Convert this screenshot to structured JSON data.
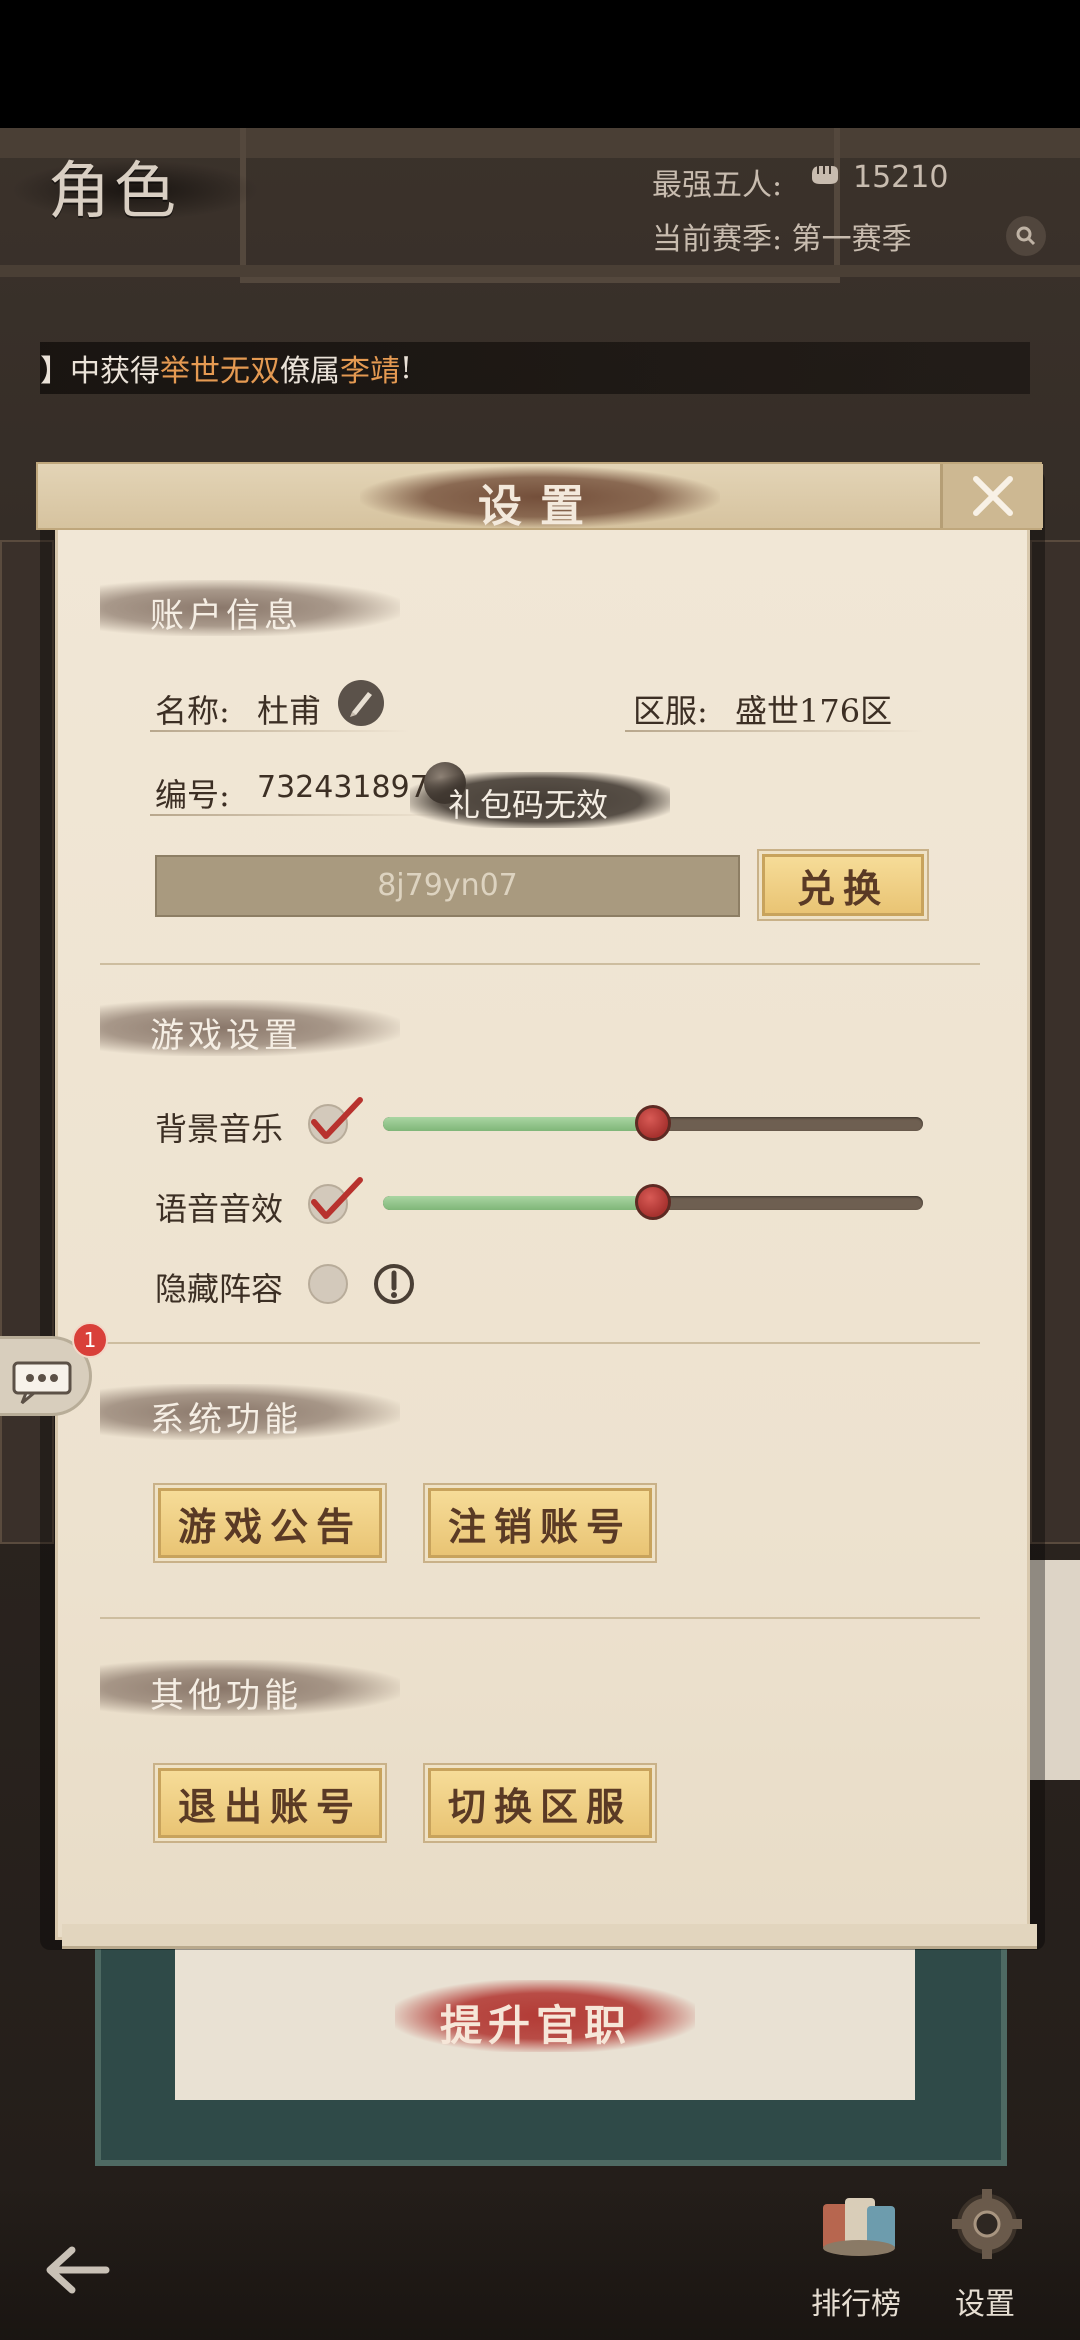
{
  "header": {
    "title": "角色",
    "strongest_label": "最强五人:",
    "strongest_value": "15210",
    "season_label": "当前赛季: 第一赛季"
  },
  "marquee": {
    "prefix": "】中获得",
    "highlight1": "举世无双",
    "middle": "僚属",
    "highlight2": "李靖",
    "suffix": "!"
  },
  "dialog": {
    "title": "设置",
    "account": {
      "section_title": "账户信息",
      "name_label": "名称:",
      "name_value": "杜甫",
      "server_label": "区服:",
      "server_value": "盛世176区",
      "id_label": "编号:",
      "id_value": "732431897",
      "toast": "礼包码无效",
      "code_value": "8j79yn07",
      "redeem_label": "兑换"
    },
    "game": {
      "section_title": "游戏设置",
      "bgm_label": "背景音乐",
      "bgm_checked": true,
      "bgm_level": 0.5,
      "voice_label": "语音音效",
      "voice_checked": true,
      "voice_level": 0.5,
      "hide_label": "隐藏阵容",
      "hide_checked": false
    },
    "system": {
      "section_title": "系统功能",
      "announcement_label": "游戏公告",
      "deregister_label": "注销账号"
    },
    "other": {
      "section_title": "其他功能",
      "logout_label": "退出账号",
      "switch_server_label": "切换区服"
    }
  },
  "chat": {
    "badge": "1"
  },
  "rank_panel": {
    "promote_label": "提升官职"
  },
  "bottom_bar": {
    "ranking_label": "排行榜",
    "settings_label": "设置"
  },
  "colors": {
    "accent_gold": "#e9c474",
    "slider_green": "#7fb678",
    "knob_red": "#a8322f",
    "highlight_orange": "#e59a52"
  }
}
